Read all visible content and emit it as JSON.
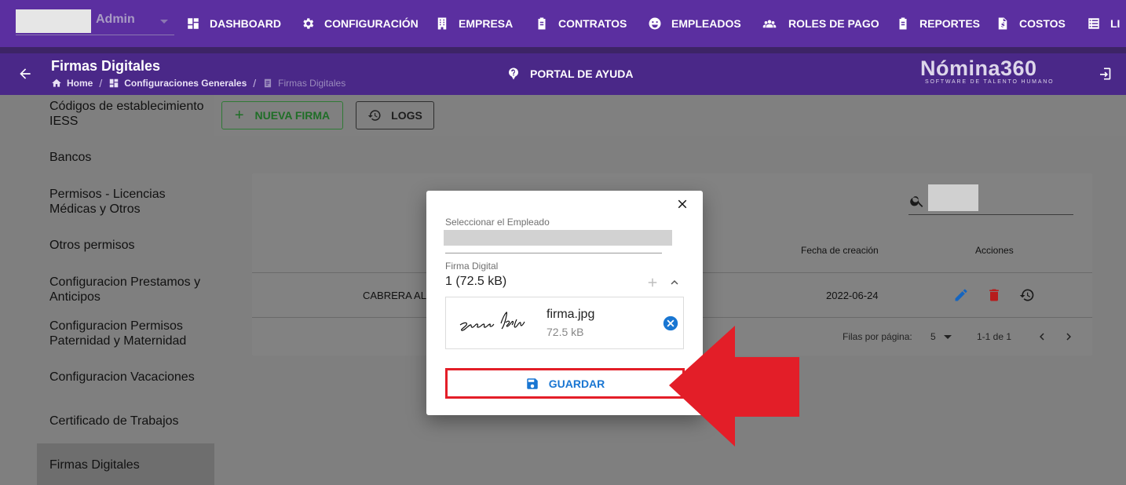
{
  "topnav": {
    "role_label": "Admin",
    "items": [
      {
        "label": "DASHBOARD",
        "icon": "dashboard-icon"
      },
      {
        "label": "CONFIGURACIÓN",
        "icon": "gear-icon"
      },
      {
        "label": "EMPRESA",
        "icon": "building-icon"
      },
      {
        "label": "CONTRATOS",
        "icon": "clipboard-icon"
      },
      {
        "label": "EMPLEADOS",
        "icon": "face-icon"
      },
      {
        "label": "ROLES DE PAGO",
        "icon": "users-icon"
      },
      {
        "label": "REPORTES",
        "icon": "clipboard-icon"
      },
      {
        "label": "COSTOS",
        "icon": "file-dollar-icon"
      },
      {
        "label": "LI",
        "icon": "list-icon"
      }
    ]
  },
  "header": {
    "title": "Firmas Digitales",
    "breadcrumb": [
      "Home",
      "Configuraciones Generales",
      "Firmas Digitales"
    ],
    "help_label": "PORTAL DE AYUDA",
    "brand_name": "Nómina360",
    "brand_tagline": "SOFTWARE DE TALENTO HUMANO"
  },
  "sidebar": {
    "items": [
      "Códigos de establecimiento IESS",
      "Bancos",
      "Permisos - Licencias Médicas y Otros",
      "Otros permisos",
      "Configuracion Prestamos y Anticipos",
      "Configuracion Permisos Paternidad y Maternidad",
      "Configuracion Vacaciones",
      "Certificado de Trabajos",
      "Firmas Digitales"
    ],
    "active_index": 8
  },
  "toolbar": {
    "new_label": "NUEVA FIRMA",
    "logs_label": "LOGS"
  },
  "table": {
    "columns": [
      "Fecha de creación",
      "Acciones"
    ],
    "rows": [
      {
        "name": "CABRERA ALC",
        "date": "2022-06-24"
      }
    ],
    "rows_per_page_label": "Filas por página:",
    "rows_per_page": "5",
    "range_label": "1-1 de 1"
  },
  "dialog": {
    "employee_label": "Seleccionar el Empleado",
    "signature_label": "Firma Digital",
    "file_count": "1 (72.5 kB)",
    "file_name": "firma.jpg",
    "file_size": "72.5 kB",
    "save_label": "GUARDAR"
  },
  "colors": {
    "nav_purple": "#5b2fa0",
    "subheader_purple": "#4a2888",
    "primary_blue": "#1976d2",
    "annotation_red": "#e31e28",
    "delete_red": "#c62828"
  }
}
